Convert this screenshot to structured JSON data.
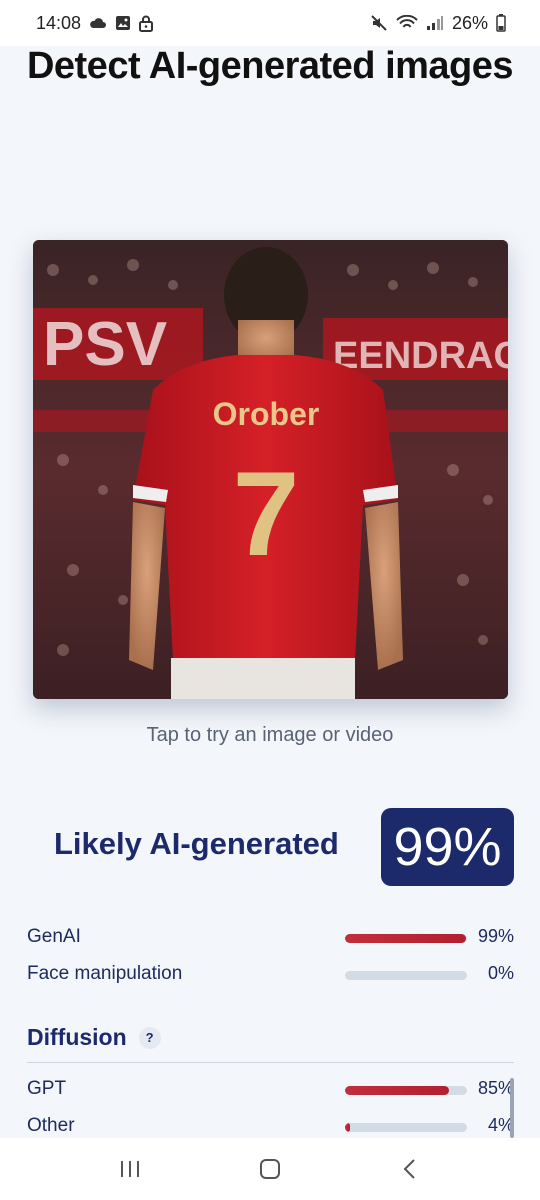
{
  "status": {
    "time": "14:08",
    "battery": "26%"
  },
  "title": "Detect AI-generated images",
  "image": {
    "banner_left": "PSV",
    "banner_right": "EENDRACHT",
    "jersey_name": "Orober",
    "jersey_number": "7"
  },
  "hint": "Tap to try an image or video",
  "verdict": {
    "label": "Likely AI-generated",
    "score": "99%"
  },
  "metrics": [
    {
      "label": "GenAI",
      "value": "99%",
      "fraction": 0.99
    },
    {
      "label": "Face manipulation",
      "value": "0%",
      "fraction": 0.0
    }
  ],
  "diffusion": {
    "title": "Diffusion",
    "help": "?",
    "items": [
      {
        "label": "GPT",
        "value": "85%",
        "fraction": 0.85
      },
      {
        "label": "Other",
        "value": "4%",
        "fraction": 0.04
      }
    ]
  },
  "colors": {
    "accent": "#1c2a6b",
    "bar": "#b2202f",
    "track": "#d3dbe7"
  }
}
